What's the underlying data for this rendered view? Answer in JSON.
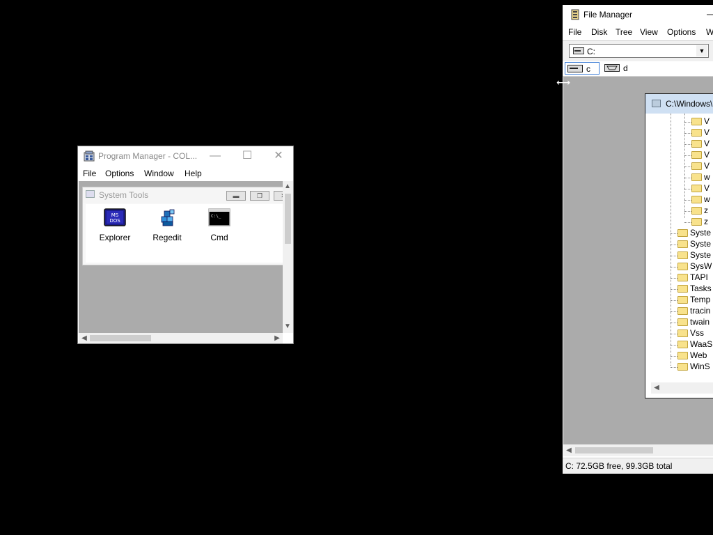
{
  "program_manager": {
    "title": "Program Manager - COL...",
    "menu": [
      "File",
      "Options",
      "Window",
      "Help"
    ],
    "group": {
      "title": "System Tools",
      "items": [
        {
          "label": "Explorer",
          "icon": "msdos-icon"
        },
        {
          "label": "Regedit",
          "icon": "regedit-icon"
        },
        {
          "label": "Cmd",
          "icon": "cmd-icon"
        }
      ]
    }
  },
  "file_manager": {
    "title": "File Manager",
    "menu": [
      "File",
      "Disk",
      "Tree",
      "View",
      "Options",
      "W"
    ],
    "drive_combo": "C:",
    "drives": [
      "c",
      "d"
    ],
    "tree_window_title": "C:\\Windows\\",
    "tree_items_deep": [
      "V",
      "V",
      "V",
      "V",
      "V",
      "w",
      "V",
      "w",
      "z",
      "z"
    ],
    "tree_items": [
      "Syste",
      "Syste",
      "Syste",
      "SysW",
      "TAPI",
      "Tasks",
      "Temp",
      "tracin",
      "twain",
      "Vss",
      "WaaS",
      "Web",
      "WinS"
    ],
    "status": "C: 72.5GB free,  99.3GB total"
  },
  "colors": {
    "desktop": "#000000",
    "mdi_background": "#ababab",
    "folder": "#f8e28c",
    "active_child_title": "#cfe0f3"
  }
}
